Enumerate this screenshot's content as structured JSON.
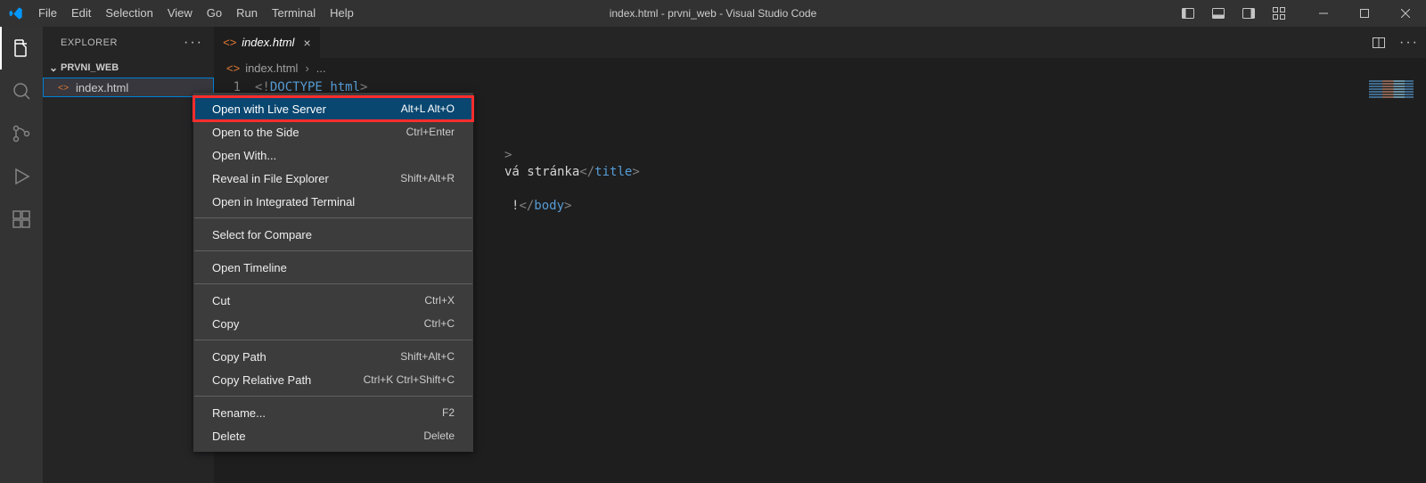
{
  "window": {
    "title": "index.html - prvni_web - Visual Studio Code"
  },
  "menu": [
    "File",
    "Edit",
    "Selection",
    "View",
    "Go",
    "Run",
    "Terminal",
    "Help"
  ],
  "sidebar": {
    "title": "EXPLORER",
    "folder": "PRVNI_WEB",
    "file": "index.html"
  },
  "tab": {
    "label": "index.html"
  },
  "breadcrumb": {
    "file": "index.html",
    "rest": "..."
  },
  "code": {
    "line_number": "1",
    "visible_line1_prefix": "<!",
    "visible_line1_doctype": "DOCTYPE",
    "visible_line1_html": "html",
    "visible_line1_suffix": ">",
    "frag_end1": ">",
    "frag_text": "vá stránka",
    "frag_closetitle": "</title>",
    "frag_body_text": "!",
    "frag_closebody": "</body>"
  },
  "context_menu": [
    {
      "label": "Open with Live Server",
      "shortcut": "Alt+L Alt+O",
      "highlight": true
    },
    {
      "label": "Open to the Side",
      "shortcut": "Ctrl+Enter"
    },
    {
      "label": "Open With...",
      "shortcut": ""
    },
    {
      "label": "Reveal in File Explorer",
      "shortcut": "Shift+Alt+R"
    },
    {
      "label": "Open in Integrated Terminal",
      "shortcut": ""
    },
    "---",
    {
      "label": "Select for Compare",
      "shortcut": ""
    },
    "---",
    {
      "label": "Open Timeline",
      "shortcut": ""
    },
    "---",
    {
      "label": "Cut",
      "shortcut": "Ctrl+X"
    },
    {
      "label": "Copy",
      "shortcut": "Ctrl+C"
    },
    "---",
    {
      "label": "Copy Path",
      "shortcut": "Shift+Alt+C"
    },
    {
      "label": "Copy Relative Path",
      "shortcut": "Ctrl+K Ctrl+Shift+C"
    },
    "---",
    {
      "label": "Rename...",
      "shortcut": "F2"
    },
    {
      "label": "Delete",
      "shortcut": "Delete"
    }
  ]
}
